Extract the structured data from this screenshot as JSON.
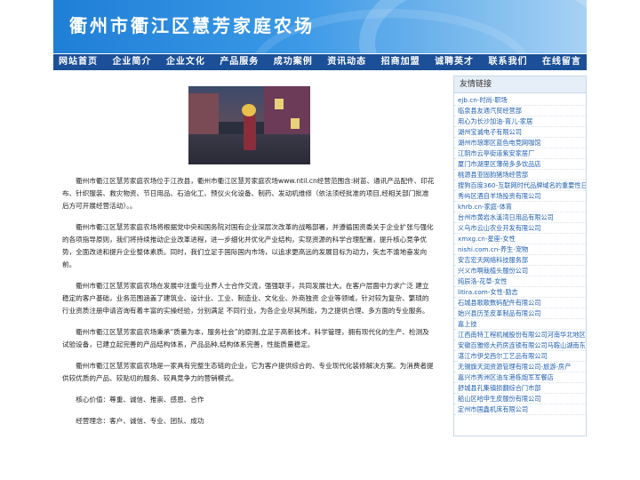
{
  "header": {
    "site_title": "衢州市衢江区慧芳家庭农场"
  },
  "nav": {
    "items": [
      "网站首页",
      "企业简介",
      "企业文化",
      "产品服务",
      "成功案例",
      "资讯动态",
      "招商加盟",
      "诚聘英才",
      "联系我们",
      "在线留言"
    ]
  },
  "content": {
    "paragraphs": [
      "衢州市衢江区慧芳家庭农场位于江孜县，衢州市衢江区慧芳家庭农场www.ntil.cn经营范围含:树苗、通讯产品配件、印花布、针织服装、救灾物资、节日用品、石油化工、预仪火化设备、制药、发动机维修（依法须经批准的项目,经相关部门批准后方可开展经营活动）。。",
      "衢州市衢江区慧芳家庭农场将根据党中央和国务院对国有企业深层次改革的战略部署，并遵循国资委关于企业扩张与强化的各项指导原则，我们将持续推动企业改革进程，进一步细化并优化产业结构，实现资源的科学合理配置，提升核心竞争优势，全面改进和提升企业整体素质。同时，我们立足于国际国内市场，以追求更高远的发展目标为动力，矢志不渝地奋发向前。",
      "衢州市衢江区慧芳家庭农场在发展中注重与业界人士合作交流，强强联手，共同发展壮大。在客户层面中力求广泛 建立稳定的客户基础，业务范围涵盖了建筑业、设计业、工业、制造业、文化业、外商独资 企业等领域，针对较为复杂、繁琐的行业资质注册申请咨询有着丰富的实操经验，分别满足 不同行业，为各企业尽其所能，为之提供合理、多方面的专业服务。",
      "衢州市衢江区慧芳家庭农场秉承“质量为本，服务社会”的原则,立足于高新技术，科学管理，拥有现代化的生产、检测及试验设备，已建立起完善的产品结构体系，产品品种,结构体系完善，性能质量稳定。",
      "衢州市衢江区慧芳家庭农场是一家具有完整生态链的企业，它为客户提供综合的、专业现代化装修解决方案。为消费者提供较优质的产品、较贴切的服务、较具竞争力的营销模式。",
      "核心价值：尊重、诚信、推崇、感恩、合作",
      "经营理念：客户、诚信、专业、团队、成功"
    ]
  },
  "sidebar": {
    "title": "友情链接",
    "links": [
      "ejb.cn-时尚-职场",
      "临泉县友通汽贸经营部",
      "用心为长沙加油-育儿-家居",
      "湖州宝诚电子有限公司",
      "湖州市琅琊区蓝色电竞网咖馆",
      "江阴市云亭街道紫安家居厂",
      "厦门市湖里区薄荷多多饮品店",
      "桃源县亚固韵猪场经营部",
      "搜狗百度360-互联网时代品牌域名的重要性日",
      "秀屿区酒自羊场投资有限公司",
      "khrb.cn-家庭-体育",
      "台州市黄岩水溪湾日用品有限公司",
      "义乌市云山农业开发有限公司",
      "xmxg.cn-星座-女性",
      "nishi.com.cn-养生-宠物",
      "安吉宏天网络科技服务部",
      "兴义市啊栽植头服份公司",
      "纯辰洛-花草-女性",
      "litira.com-女性-励志",
      "石城县歌歌数码配件有限公司",
      "始兴县历圣皮革制品有限公司",
      "嘉上技",
      "江西南特工程机械股份有限公司河南华北地区",
      "安徽百雅修大药房连锁有限公司马鞍山湖南东",
      "湛江市伊戈西尔工艺品有限公司",
      "无锡旗天润资源管理有限公司-旅游-房产",
      "嘉兴市秀洲区油车港栋炮军军餐店",
      "舒城县孔集镇损翻综合门市部",
      "船山区哈申生皮服份有限公司",
      "定州市国鑫机床有限公司"
    ]
  }
}
